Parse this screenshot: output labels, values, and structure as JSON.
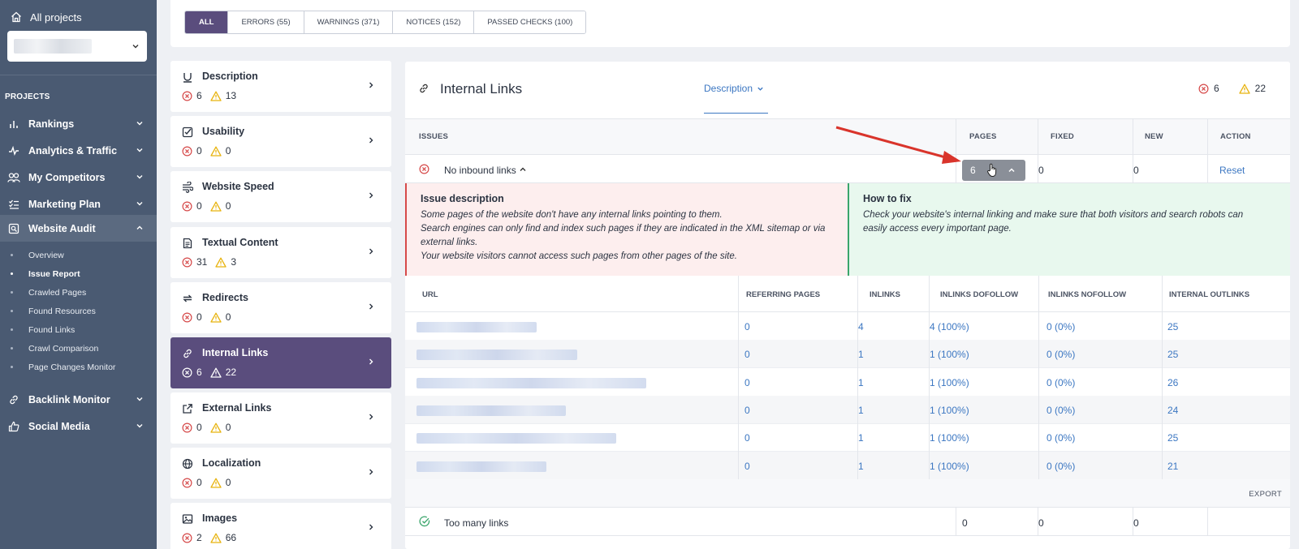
{
  "sidebar": {
    "all_projects": "All projects",
    "projects_heading": "PROJECTS",
    "items": [
      {
        "label": "Rankings",
        "icon": "bar-chart-icon"
      },
      {
        "label": "Analytics & Traffic",
        "icon": "pulse-icon"
      },
      {
        "label": "My Competitors",
        "icon": "users-icon"
      },
      {
        "label": "Marketing Plan",
        "icon": "checklist-icon"
      },
      {
        "label": "Website Audit",
        "icon": "audit-icon"
      },
      {
        "label": "Backlink Monitor",
        "icon": "link-icon"
      },
      {
        "label": "Social Media",
        "icon": "thumbs-up-icon"
      }
    ],
    "sub_items": [
      "Overview",
      "Issue Report",
      "Crawled Pages",
      "Found Resources",
      "Found Links",
      "Crawl Comparison",
      "Page Changes Monitor"
    ],
    "active_sub": "Issue Report"
  },
  "filters": [
    "ALL",
    "ERRORS (55)",
    "WARNINGS (371)",
    "NOTICES (152)",
    "PASSED CHECKS (100)"
  ],
  "categories": [
    {
      "name": "Description",
      "errors": "6",
      "warnings": "13",
      "icon": "heading-icon"
    },
    {
      "name": "Usability",
      "errors": "0",
      "warnings": "0",
      "icon": "checkbox-icon"
    },
    {
      "name": "Website Speed",
      "errors": "0",
      "warnings": "0",
      "icon": "speed-icon"
    },
    {
      "name": "Textual Content",
      "errors": "31",
      "warnings": "3",
      "icon": "document-icon"
    },
    {
      "name": "Redirects",
      "errors": "0",
      "warnings": "0",
      "icon": "redirect-icon"
    },
    {
      "name": "Internal Links",
      "errors": "6",
      "warnings": "22",
      "icon": "link-icon"
    },
    {
      "name": "External Links",
      "errors": "0",
      "warnings": "0",
      "icon": "external-link-icon"
    },
    {
      "name": "Localization",
      "errors": "0",
      "warnings": "0",
      "icon": "globe-icon"
    },
    {
      "name": "Images",
      "errors": "2",
      "warnings": "66",
      "icon": "image-icon"
    }
  ],
  "main": {
    "title": "Internal Links",
    "description_dropdown": "Description",
    "errors": "6",
    "warnings": "22",
    "headers": {
      "issues": "ISSUES",
      "pages": "PAGES",
      "fixed": "FIXED",
      "new": "NEW",
      "action": "ACTION"
    },
    "issue": {
      "name": "No inbound links",
      "pages": "6",
      "fixed": "0",
      "new": "0",
      "action": "Reset"
    },
    "issue_description": {
      "title": "Issue description",
      "lines": [
        "Some pages of the website don't have any internal links pointing to them.",
        "Search engines can only find and index such pages if they are indicated in the XML sitemap or via",
        "external links.",
        "Your website visitors cannot access such pages from other pages of the site."
      ]
    },
    "how_to_fix": {
      "title": "How to fix",
      "lines": [
        "Check your website's internal linking and make sure that both visitors and search robots can",
        "easily access every important page."
      ]
    },
    "url_headers": {
      "url": "URL",
      "referring": "REFERRING PAGES",
      "inlinks": "INLINKS",
      "dofollow": "INLINKS DOFOLLOW",
      "nofollow": "INLINKS NOFOLLOW",
      "outlinks": "INTERNAL OUTLINKS"
    },
    "url_rows": [
      {
        "referring": "0",
        "inlinks": "4",
        "dofollow": "4 (100%)",
        "nofollow": "0 (0%)",
        "outlinks": "25"
      },
      {
        "referring": "0",
        "inlinks": "1",
        "dofollow": "1 (100%)",
        "nofollow": "0 (0%)",
        "outlinks": "25"
      },
      {
        "referring": "0",
        "inlinks": "1",
        "dofollow": "1 (100%)",
        "nofollow": "0 (0%)",
        "outlinks": "26"
      },
      {
        "referring": "0",
        "inlinks": "1",
        "dofollow": "1 (100%)",
        "nofollow": "0 (0%)",
        "outlinks": "24"
      },
      {
        "referring": "0",
        "inlinks": "1",
        "dofollow": "1 (100%)",
        "nofollow": "0 (0%)",
        "outlinks": "25"
      },
      {
        "referring": "0",
        "inlinks": "1",
        "dofollow": "1 (100%)",
        "nofollow": "0 (0%)",
        "outlinks": "21"
      }
    ],
    "export_label": "EXPORT",
    "issue2": {
      "name": "Too many links",
      "pages": "0",
      "fixed": "0",
      "new": "0"
    }
  },
  "colors": {
    "accent": "#5a4d7d",
    "sidebar": "#4a5a72",
    "link": "#3c77c2",
    "error": "#d64a4a",
    "warning": "#e8b30f",
    "arrow": "#d9342b"
  }
}
